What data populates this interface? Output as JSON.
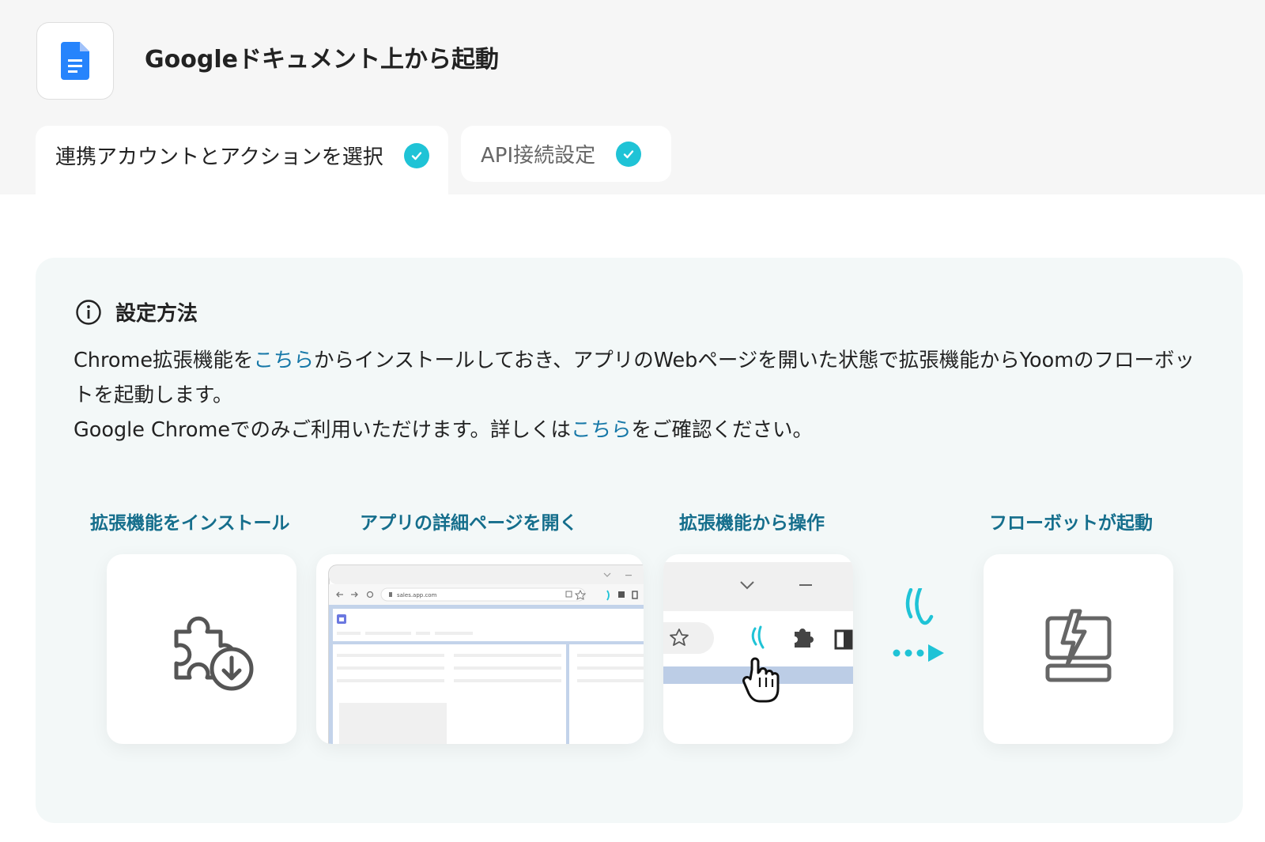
{
  "header": {
    "app_icon": "google-docs-icon",
    "title": "Googleドキュメント上から起動"
  },
  "tabs": [
    {
      "label": "連携アカウントとアクションを選択",
      "status": "completed"
    },
    {
      "label": "API接続設定",
      "status": "completed"
    }
  ],
  "info": {
    "icon": "info-icon",
    "title": "設定方法",
    "line1_before": "Chrome拡張機能を",
    "line1_link": "こちら",
    "line1_after": "からインストールしておき、アプリのWebページを開いた状態で拡張機能からYoomのフローボットを起動します。",
    "line2_before": "Google Chromeでのみご利用いただけます。詳しくは",
    "line2_link": "こちら",
    "line2_after": "をご確認ください。"
  },
  "steps": [
    {
      "label": "拡張機能をインストール",
      "icon": "puzzle-download-icon"
    },
    {
      "label": "アプリの詳細ページを開く",
      "icon": "browser-window-illustration"
    },
    {
      "label": "拡張機能から操作",
      "icon": "browser-toolbar-illustration"
    },
    {
      "label": "フローボットが起動",
      "icon": "flowbot-lightning-icon"
    }
  ],
  "browser": {
    "url": "sales.app.com"
  },
  "colors": {
    "accent": "#1fc3d6",
    "link": "#1678a8",
    "step_label": "#156e8c",
    "panel_bg": "#f3f8f8",
    "header_bg": "#f6f6f6"
  }
}
